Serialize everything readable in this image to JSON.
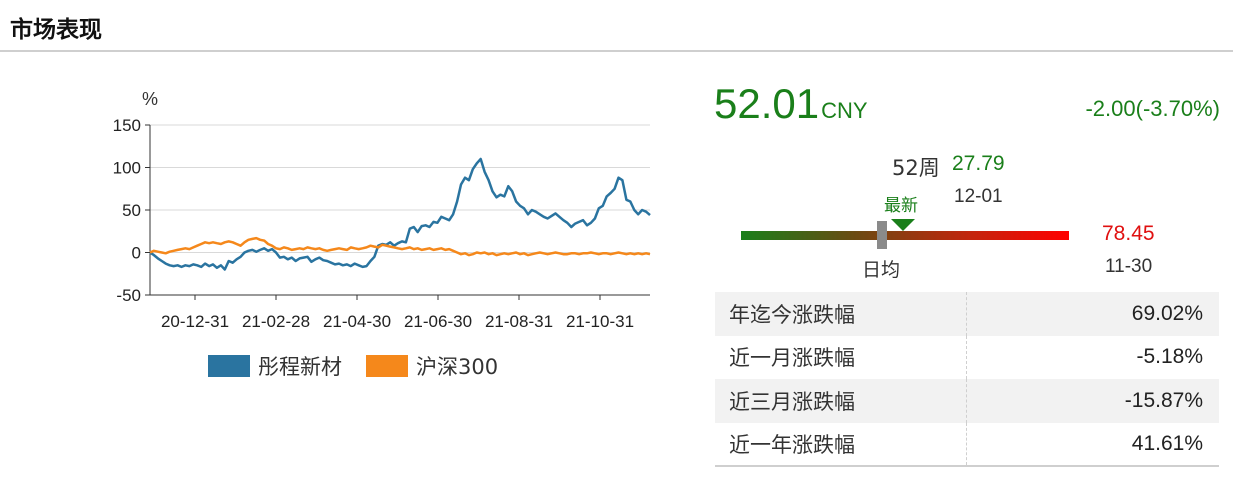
{
  "header": {
    "title": "市场表现"
  },
  "chart_data": {
    "type": "line",
    "ylabel": "%",
    "ylim": [
      -50,
      150
    ],
    "yticks": [
      150,
      100,
      50,
      0,
      -50
    ],
    "xticks": [
      "20-12-31",
      "21-02-28",
      "21-04-30",
      "21-06-30",
      "21-08-31",
      "21-10-31"
    ],
    "grid": true,
    "legend_placement": "bottom",
    "series": [
      {
        "name": "彤程新材",
        "color": "#2a74a0",
        "values": [
          0,
          -3,
          -7,
          -10,
          -13,
          -15,
          -16,
          -15,
          -17,
          -15,
          -16,
          -14,
          -15,
          -17,
          -13,
          -16,
          -14,
          -18,
          -15,
          -20,
          -10,
          -12,
          -8,
          -5,
          0,
          2,
          3,
          1,
          3,
          5,
          2,
          4,
          0,
          -6,
          -5,
          -8,
          -6,
          -10,
          -7,
          -6,
          -5,
          -11,
          -8,
          -6,
          -9,
          -10,
          -12,
          -14,
          -13,
          -15,
          -14,
          -16,
          -13,
          -15,
          -17,
          -16,
          -10,
          -5,
          8,
          10,
          9,
          12,
          8,
          11,
          13,
          12,
          28,
          30,
          24,
          31,
          32,
          30,
          36,
          35,
          42,
          40,
          38,
          45,
          60,
          80,
          88,
          85,
          98,
          105,
          110,
          95,
          85,
          72,
          65,
          68,
          66,
          78,
          72,
          60,
          55,
          52,
          45,
          50,
          48,
          45,
          42,
          40,
          43,
          46,
          42,
          38,
          35,
          30,
          34,
          36,
          38,
          32,
          35,
          40,
          52,
          55,
          66,
          70,
          75,
          88,
          85,
          62,
          60,
          50,
          45,
          50,
          48,
          44
        ],
        "summary": "rises to ~108 in late July 2021, ends near 44"
      },
      {
        "name": "沪深300",
        "color": "#f5881b",
        "values": [
          0,
          2,
          1,
          0,
          -1,
          1,
          2,
          3,
          4,
          5,
          4,
          6,
          8,
          10,
          12,
          11,
          12,
          11,
          10,
          12,
          13,
          12,
          10,
          8,
          12,
          15,
          16,
          17,
          15,
          14,
          10,
          8,
          5,
          4,
          6,
          5,
          3,
          4,
          5,
          4,
          6,
          5,
          4,
          5,
          3,
          2,
          3,
          4,
          5,
          4,
          3,
          6,
          5,
          4,
          5,
          6,
          8,
          7,
          6,
          9,
          8,
          7,
          6,
          5,
          4,
          5,
          6,
          4,
          5,
          3,
          4,
          5,
          3,
          4,
          5,
          3,
          4,
          2,
          0,
          -2,
          -1,
          -3,
          -2,
          0,
          -1,
          0,
          -2,
          -1,
          -3,
          -2,
          -1,
          -2,
          -1,
          0,
          -2,
          -1,
          -3,
          -2,
          -1,
          0,
          -1,
          -2,
          -1,
          0,
          -1,
          -2,
          -2,
          -1,
          -1,
          -2,
          -1,
          -1,
          0,
          -1,
          -2,
          -1,
          -1,
          -2,
          -1,
          0,
          -1,
          -2,
          -1,
          -2,
          -1,
          -2,
          -1,
          -2
        ]
      }
    ]
  },
  "quote": {
    "price": "52.01",
    "currency": "CNY",
    "change": "-2.00(-3.70%)"
  },
  "range": {
    "period_label": "52周",
    "low_value": "27.79",
    "low_date": "12-01",
    "latest_label": "最新",
    "avg_label": "日均",
    "high_value": "78.45",
    "high_date": "11-30"
  },
  "performance": {
    "rows": [
      {
        "label": "年迄今涨跌幅",
        "value": "69.02%"
      },
      {
        "label": "近一月涨跌幅",
        "value": "-5.18%"
      },
      {
        "label": "近三月涨跌幅",
        "value": "-15.87%"
      },
      {
        "label": "近一年涨跌幅",
        "value": "41.61%"
      }
    ]
  }
}
